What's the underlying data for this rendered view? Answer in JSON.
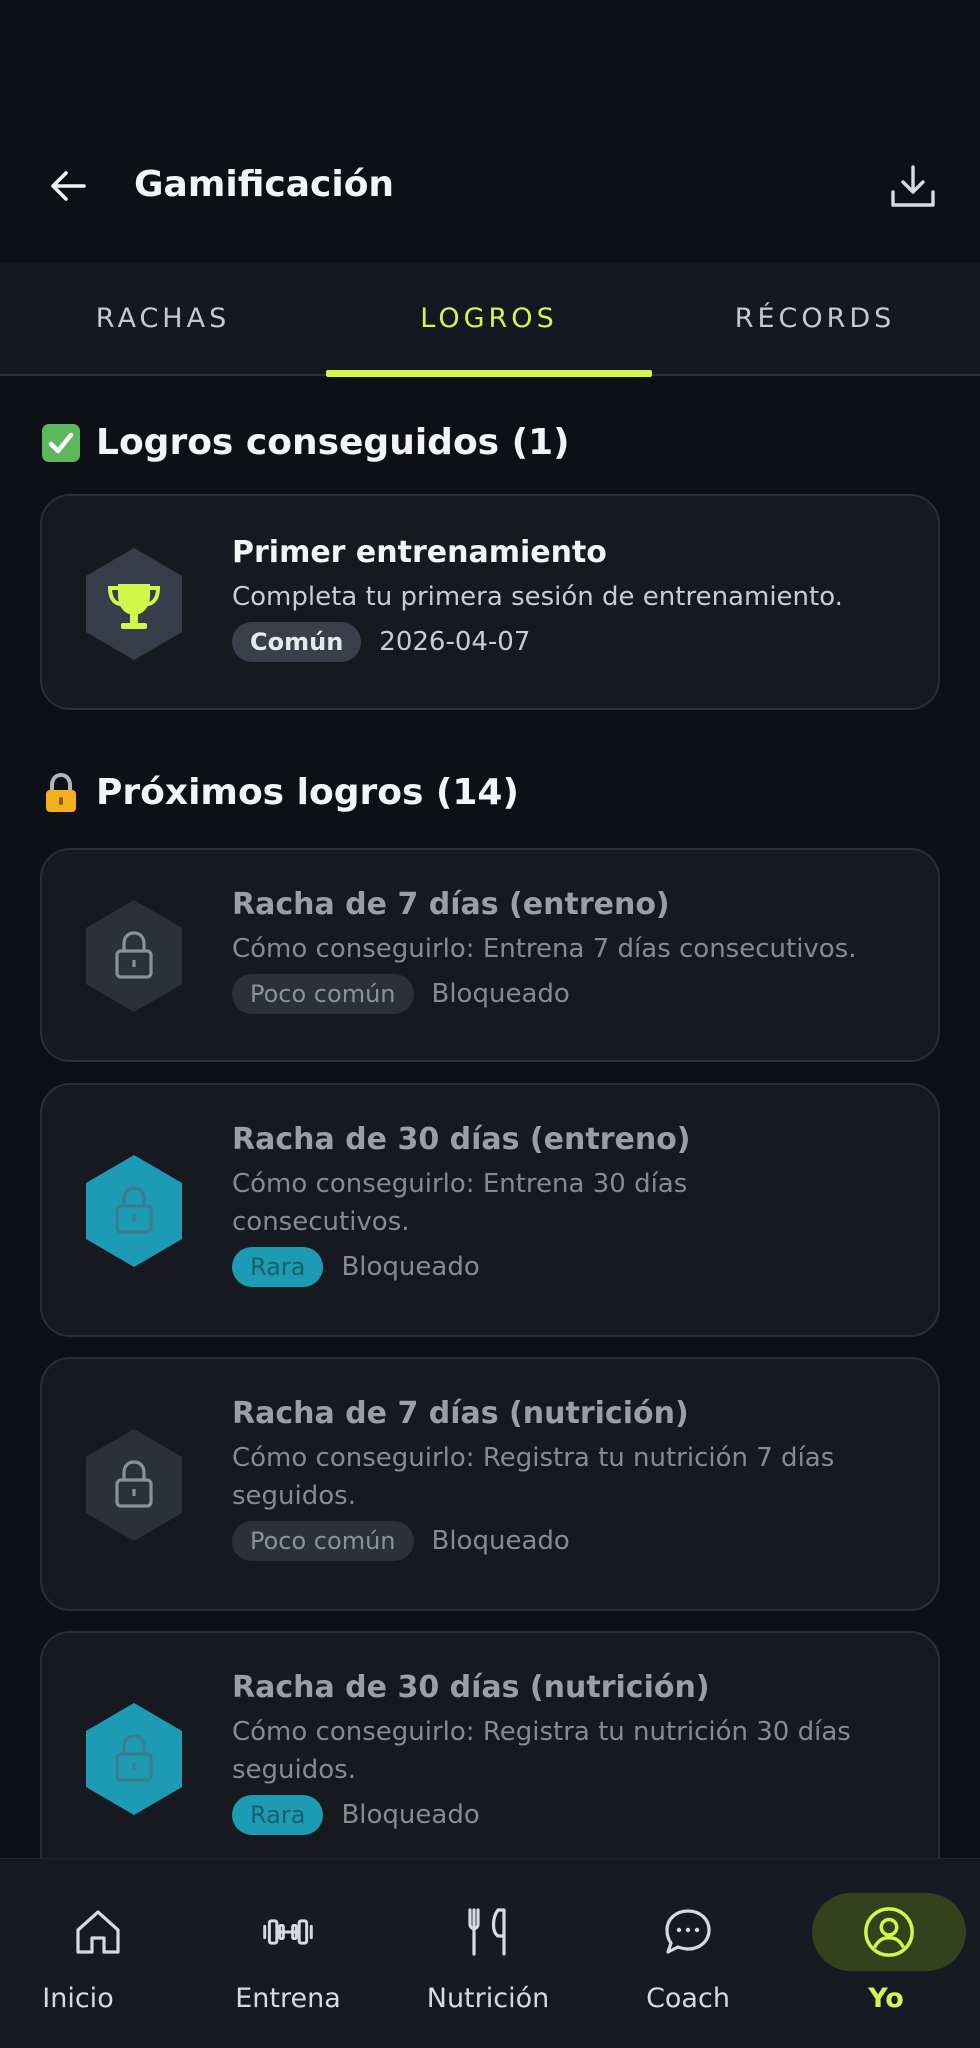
{
  "header": {
    "title": "Gamificación",
    "back_icon": "arrow-left-icon",
    "download_icon": "download-icon"
  },
  "tabs": [
    {
      "label": "RACHAS",
      "active": false
    },
    {
      "label": "LOGROS",
      "active": true
    },
    {
      "label": "RÉCORDS",
      "active": false
    }
  ],
  "achieved": {
    "title": "Logros conseguidos (1)",
    "emoji": "check-mark-icon",
    "items": [
      {
        "title": "Primer entrenamiento",
        "description": "Completa tu primera sesión de entrenamiento.",
        "rarity": "Común",
        "date": "2026-04-07",
        "icon": "trophy-icon"
      }
    ]
  },
  "upcoming": {
    "title": "Próximos logros (14)",
    "emoji": "lock-icon",
    "items": [
      {
        "title": "Racha de 7 días (entreno)",
        "description": "Cómo conseguirlo: Entrena 7 días consecutivos.",
        "rarity": "Poco común",
        "status": "Bloqueado"
      },
      {
        "title": "Racha de 30 días (entreno)",
        "description": "Cómo conseguirlo: Entrena 30 días consecutivos.",
        "rarity": "Rara",
        "status": "Bloqueado"
      },
      {
        "title": "Racha de 7 días (nutrición)",
        "description": "Cómo conseguirlo: Registra tu nutrición 7 días seguidos.",
        "rarity": "Poco común",
        "status": "Bloqueado"
      },
      {
        "title": "Racha de 30 días (nutrición)",
        "description": "Cómo conseguirlo: Registra tu nutrición 30 días seguidos.",
        "rarity": "Rara",
        "status": "Bloqueado"
      }
    ]
  },
  "nav": [
    {
      "label": "Inicio",
      "icon": "home-icon",
      "active": false
    },
    {
      "label": "Entrena",
      "icon": "dumbbell-icon",
      "active": false
    },
    {
      "label": "Nutrición",
      "icon": "fork-knife-icon",
      "active": false
    },
    {
      "label": "Coach",
      "icon": "chat-bubble-icon",
      "active": false
    },
    {
      "label": "Yo",
      "icon": "profile-icon",
      "active": true
    }
  ],
  "colors": {
    "background": "#0e1016",
    "accent": "#d4f54a",
    "rare": "#1e9bb4",
    "card": "#161920"
  }
}
